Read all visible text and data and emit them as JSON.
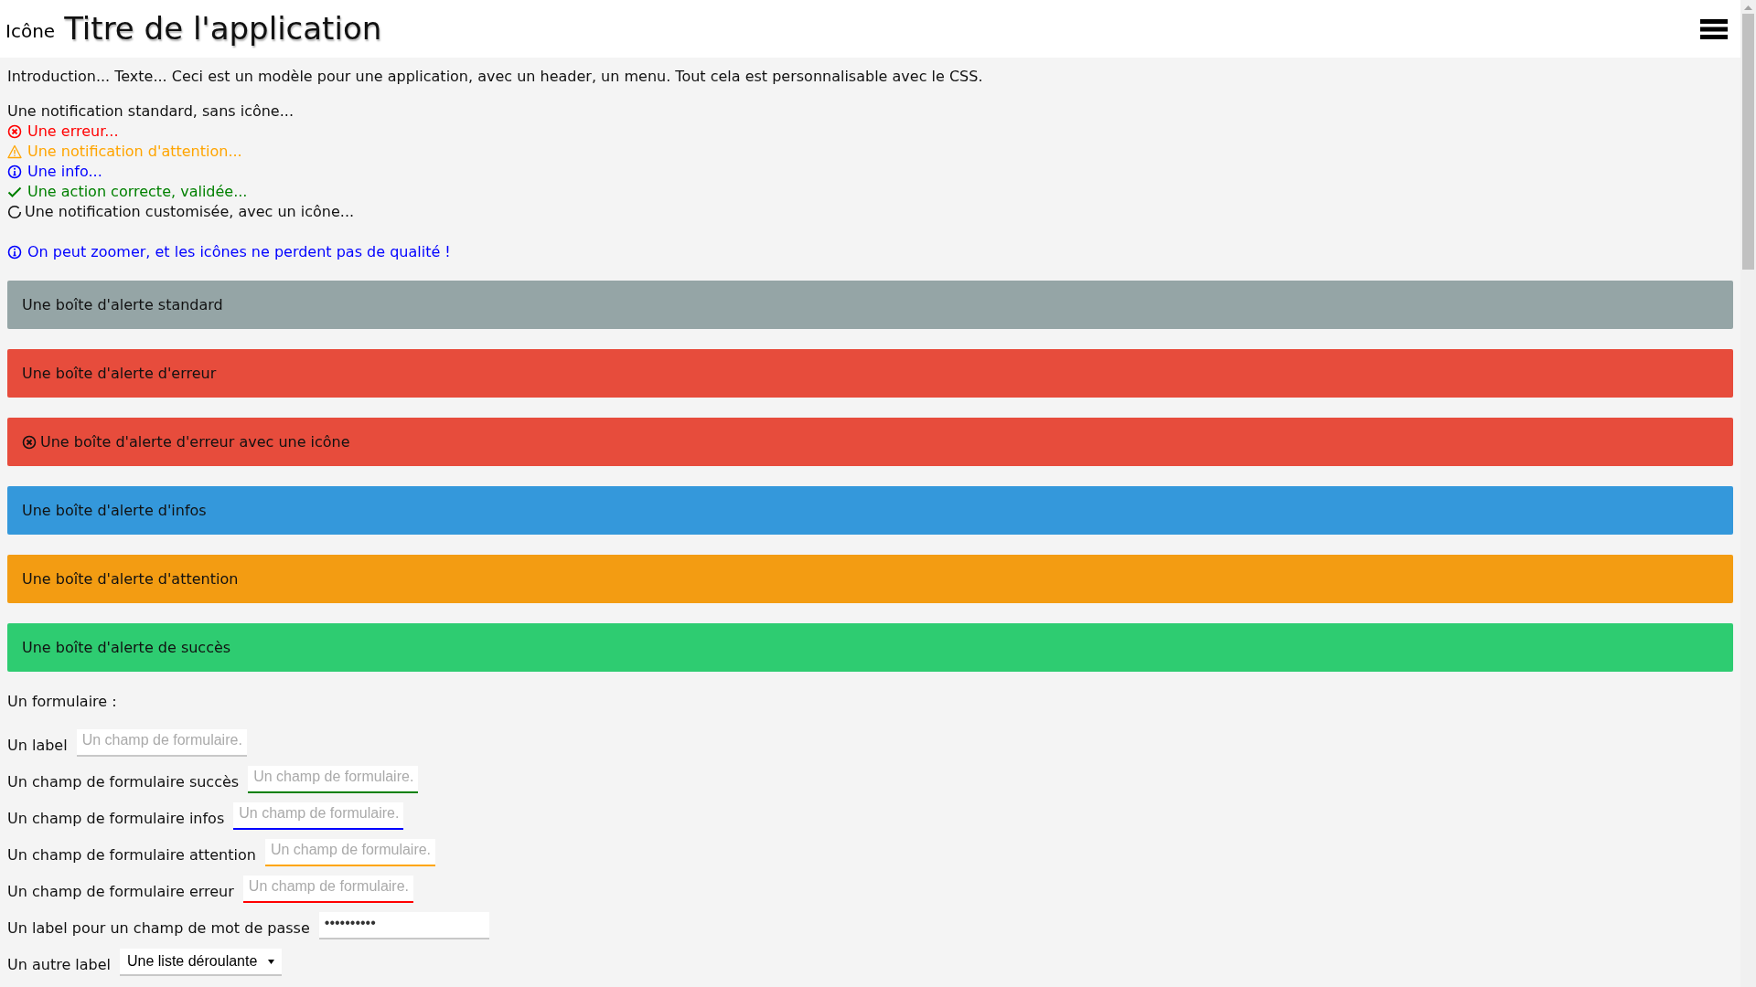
{
  "header": {
    "icon_label": "Icône",
    "title": "Titre de l'application"
  },
  "intro": "Introduction... Texte... Ceci est un modèle pour une application, avec un header, un menu. Tout cela est personnalisable avec le CSS.",
  "notifications": [
    {
      "kind": "standard",
      "text": "Une notification standard, sans icône..."
    },
    {
      "kind": "error",
      "text": "Une erreur..."
    },
    {
      "kind": "warning",
      "text": "Une notification d'attention..."
    },
    {
      "kind": "info",
      "text": "Une info..."
    },
    {
      "kind": "success",
      "text": "Une action correcte, validée..."
    },
    {
      "kind": "custom",
      "text": "Une notification customisée, avec un icône..."
    }
  ],
  "zoom_note": {
    "kind": "info",
    "text": "On peut zoomer, et les icônes ne perdent pas de qualité !"
  },
  "alerts": [
    {
      "kind": "standard",
      "icon": false,
      "text": "Une boîte d'alerte standard"
    },
    {
      "kind": "error",
      "icon": false,
      "text": "Une boîte d'alerte d'erreur"
    },
    {
      "kind": "error",
      "icon": true,
      "text": "Une boîte d'alerte d'erreur avec une icône"
    },
    {
      "kind": "info",
      "icon": false,
      "text": "Une boîte d'alerte d'infos"
    },
    {
      "kind": "warning",
      "icon": false,
      "text": "Une boîte d'alerte d'attention"
    },
    {
      "kind": "success",
      "icon": false,
      "text": "Une boîte d'alerte de succès"
    }
  ],
  "form": {
    "title": "Un formulaire :",
    "fields": [
      {
        "kind": "default",
        "label": "Un label",
        "placeholder": "Un champ de formulaire."
      },
      {
        "kind": "success",
        "label": "Un champ de formulaire succès",
        "placeholder": "Un champ de formulaire."
      },
      {
        "kind": "info",
        "label": "Un champ de formulaire infos",
        "placeholder": "Un champ de formulaire."
      },
      {
        "kind": "warning",
        "label": "Un champ de formulaire attention",
        "placeholder": "Un champ de formulaire."
      },
      {
        "kind": "error",
        "label": "Un champ de formulaire erreur",
        "placeholder": "Un champ de formulaire."
      },
      {
        "kind": "password",
        "label": "Un label pour un champ de mot de passe",
        "value": "••••••••••"
      },
      {
        "kind": "select",
        "label": "Un autre label",
        "value": "Une liste déroulante"
      }
    ]
  }
}
